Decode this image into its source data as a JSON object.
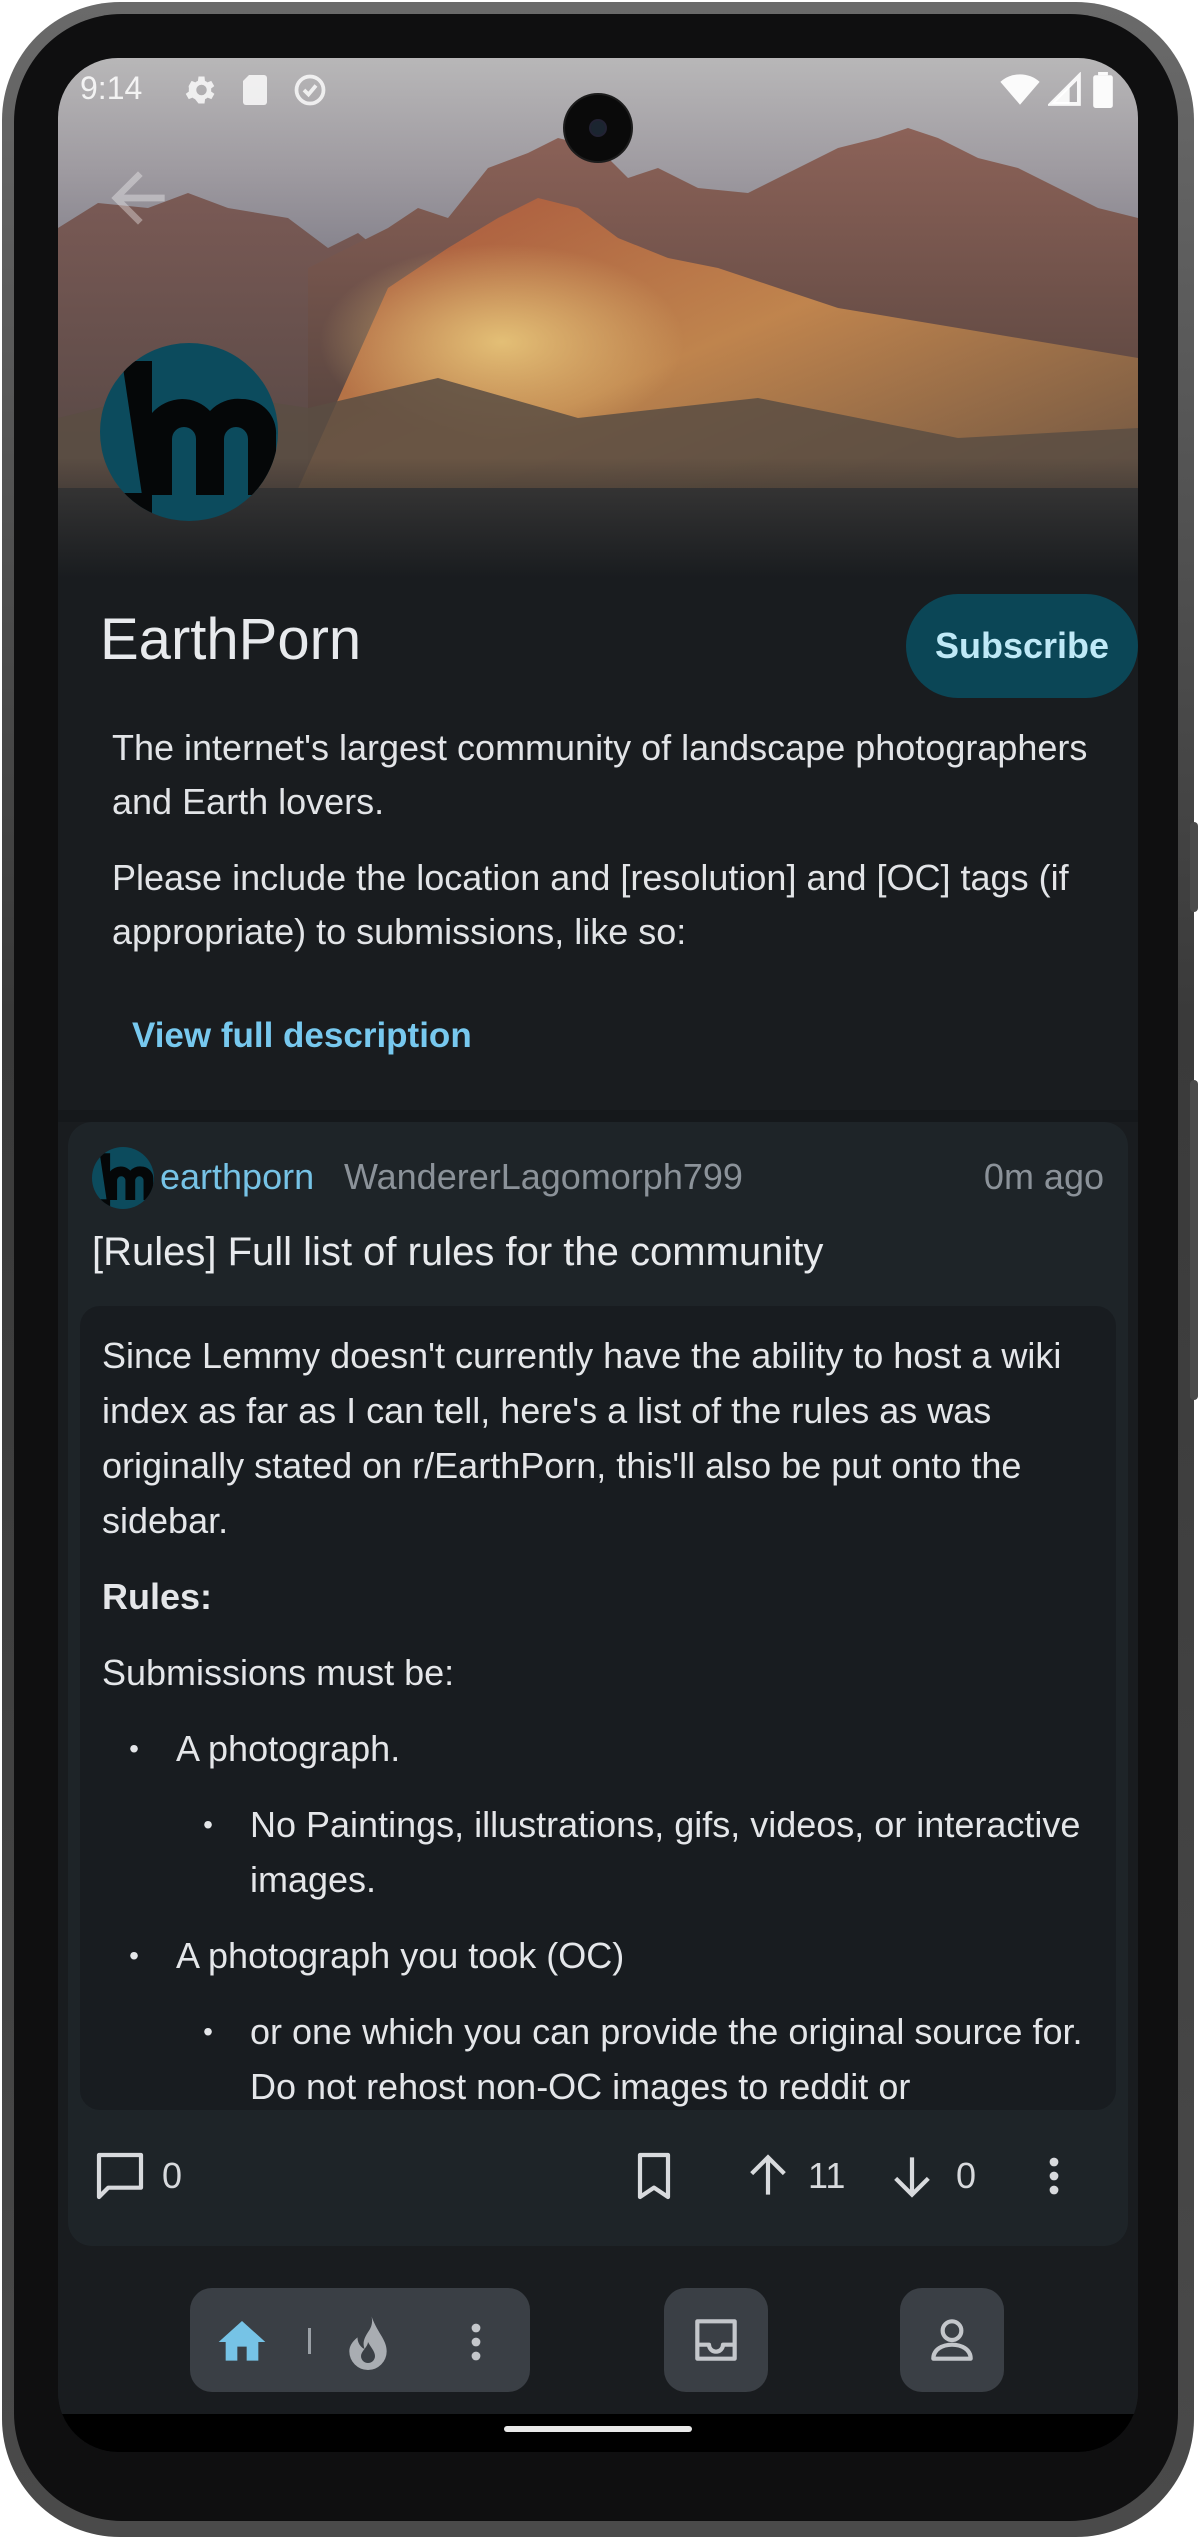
{
  "status_bar": {
    "time": "9:14"
  },
  "community": {
    "name": "EarthPorn",
    "subscribe_label": "Subscribe",
    "description": [
      "The internet's largest community of landscape photographers and Earth lovers.",
      "Please include the location and [resolution] and [OC] tags (if appropriate) to submissions, like so:"
    ],
    "view_full_label": "View full description"
  },
  "post": {
    "community": "earthporn",
    "author": "WandererLagomorph799",
    "time": "0m ago",
    "title": "[Rules] Full list of rules for the community",
    "body": {
      "intro": "Since Lemmy doesn't currently have the ability to host a wiki index as far as I can tell, here's a list of the rules as was originally stated on r/EarthPorn, this'll also be put onto the sidebar.",
      "rules_heading": "Rules:",
      "submissions_line": "Submissions must be:",
      "items": [
        {
          "level": 1,
          "text": "A photograph."
        },
        {
          "level": 2,
          "text": "No Paintings, illustrations, gifs, videos, or interactive images."
        },
        {
          "level": 1,
          "text": "A photograph you took (OC)"
        },
        {
          "level": 2,
          "text": "or one which you can provide the original source for. Do not rehost non-OC images to reddit or"
        }
      ]
    },
    "comments_count": "0",
    "upvotes": "11",
    "downvotes": "0"
  },
  "icons": {
    "status": [
      "settings-icon",
      "sd-card-icon",
      "data-saver-icon",
      "wifi-icon",
      "signal-icon",
      "battery-icon"
    ],
    "actions": [
      "comment-icon",
      "bookmark-icon",
      "upvote-icon",
      "downvote-icon",
      "more-vert-icon"
    ],
    "nav": [
      "home-icon",
      "hot-icon",
      "more-vert-icon",
      "inbox-icon",
      "account-icon"
    ]
  },
  "colors": {
    "accent": "#76c3e6",
    "subscribe_bg": "#0b4656",
    "subscribe_text": "#bfe9f7",
    "background": "#191c1f",
    "card": "#1e2428"
  }
}
